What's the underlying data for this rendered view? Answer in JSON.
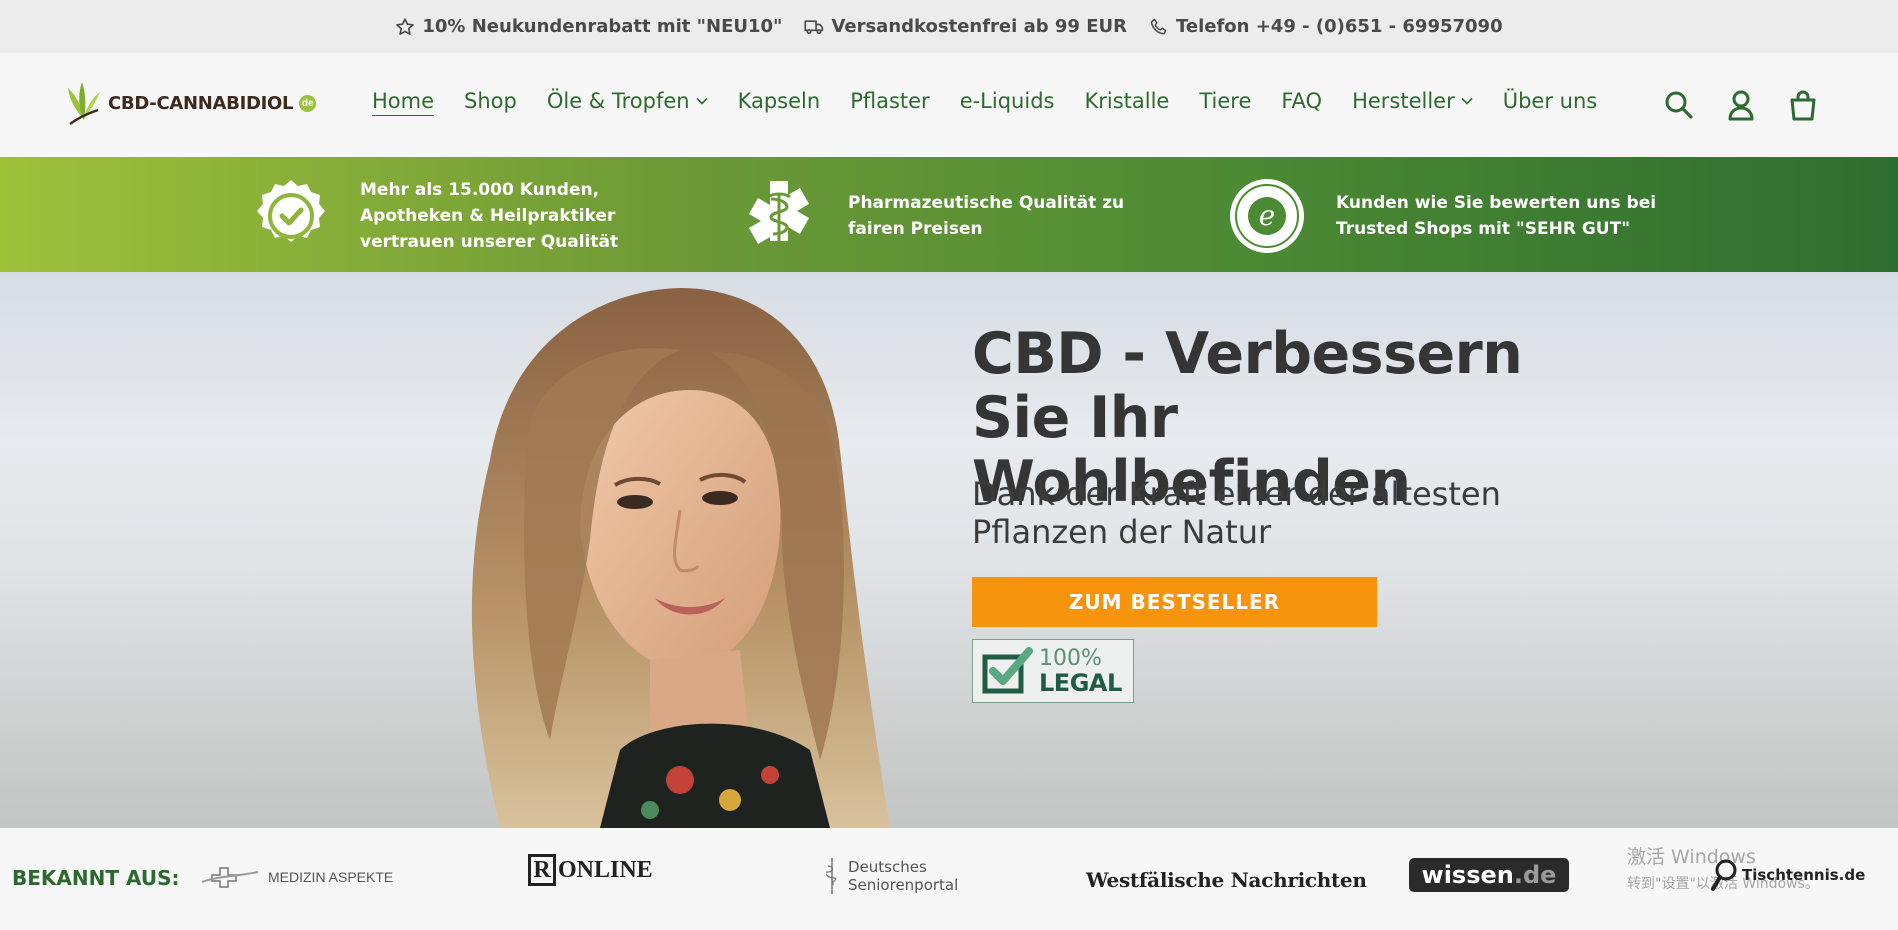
{
  "topbar": {
    "items": [
      {
        "icon": "star-icon",
        "text": "10% Neukundenrabatt mit \"NEU10\""
      },
      {
        "icon": "truck-icon",
        "text": "Versandkostenfrei ab 99 EUR"
      },
      {
        "icon": "phone-icon",
        "text": "Telefon +49 - (0)651 - 69957090"
      }
    ]
  },
  "header": {
    "logo": {
      "text": "CBD-CANNABIDIOL",
      "suffix": "de"
    },
    "nav": [
      {
        "label": "Home",
        "active": true
      },
      {
        "label": "Shop"
      },
      {
        "label": "Öle & Tropfen",
        "dropdown": true
      },
      {
        "label": "Kapseln"
      },
      {
        "label": "Pflaster"
      },
      {
        "label": "e-Liquids"
      },
      {
        "label": "Kristalle"
      },
      {
        "label": "Tiere"
      },
      {
        "label": "FAQ"
      },
      {
        "label": "Hersteller",
        "dropdown": true
      },
      {
        "label": "Über uns"
      }
    ],
    "icons": [
      "search-icon",
      "account-icon",
      "cart-icon"
    ]
  },
  "benefits": [
    {
      "icon": "check-seal-icon",
      "text": [
        "Mehr als 15.000 Kunden,",
        "Apotheken & Heilpraktiker",
        "vertrauen unserer Qualität"
      ]
    },
    {
      "icon": "caduceus-icon",
      "text": [
        "Pharmazeutische Qualität zu",
        "fairen Preisen"
      ]
    },
    {
      "icon": "trusted-shops-icon",
      "text": [
        "Kunden wie Sie bewerten uns bei",
        "Trusted Shops mit \"SEHR GUT\""
      ],
      "badge_text": "e"
    }
  ],
  "hero": {
    "title": "CBD - Verbessern Sie Ihr Wohlbefinden",
    "subtitle": "Dank der Kraft einer der ältesten Pflanzen der Natur",
    "cta": "ZUM BESTSELLER",
    "badge": {
      "pct": "100%",
      "word": "LEGAL"
    }
  },
  "press": {
    "label": "BEKANNT AUS:",
    "logos": {
      "medizin": "MEDIZIN ASPEKTE",
      "r_online_mark": "R",
      "r_online": "ONLINE",
      "dsp_line1": "Deutsches",
      "dsp_line2": "Seniorenportal",
      "wn": "Westfälische Nachrichten",
      "wissen_main": "wissen",
      "wissen_dot": ".de",
      "tt": "Tischtennis.de"
    }
  },
  "watermark": {
    "line1": "激活 Windows",
    "line2": "转到\"设置\"以激活 Windows。"
  },
  "colors": {
    "green": "#2b6a2e",
    "orange": "#f7940d",
    "band_start": "#9ec13a",
    "band_end": "#2e6d30"
  }
}
